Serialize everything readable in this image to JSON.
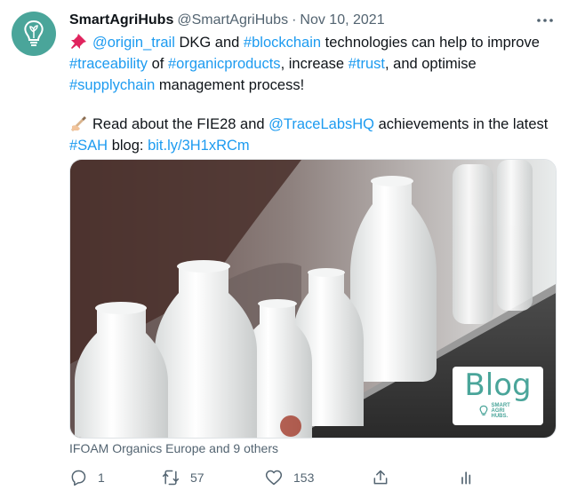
{
  "tweet": {
    "author_name": "SmartAgriHubs",
    "author_handle": "@SmartAgriHubs",
    "separator": "·",
    "date": "Nov 10, 2021",
    "line1": {
      "mention": "@origin_trail",
      "t1": " DKG and ",
      "tag": "#blockchain",
      "t2": " technologies can help to improve"
    },
    "line2": {
      "tag1": "#traceability",
      "t1": " of ",
      "tag2": "#organicproducts",
      "t2": ", increase ",
      "tag3": "#trust",
      "t3": ", and optimise"
    },
    "line3": {
      "tag": "#supplychain",
      "t1": " management process!"
    },
    "line4": {
      "t1": "Read about the FIE28 and ",
      "mention": "@TraceLabsHQ",
      "t2": " achievements in the latest"
    },
    "line5": {
      "tag": "#SAH",
      "t1": " blog: ",
      "url": "bit.ly/3H1xRCm"
    },
    "media": {
      "badge_title": "Blog",
      "badge_brand": "SMART AGRI HUBS."
    },
    "tagged_text": "IFOAM Organics Europe and 9 others",
    "counts": {
      "replies": "1",
      "retweets": "57",
      "likes": "153"
    }
  },
  "colors": {
    "link": "#1d9bf0",
    "brand": "#4aa59a",
    "muted": "#536471"
  },
  "icons": [
    "lightbulb-sprout-icon",
    "more-icon",
    "pushpin-icon",
    "writing-hand-icon",
    "reply-icon",
    "retweet-icon",
    "like-icon",
    "share-icon",
    "analytics-icon"
  ]
}
